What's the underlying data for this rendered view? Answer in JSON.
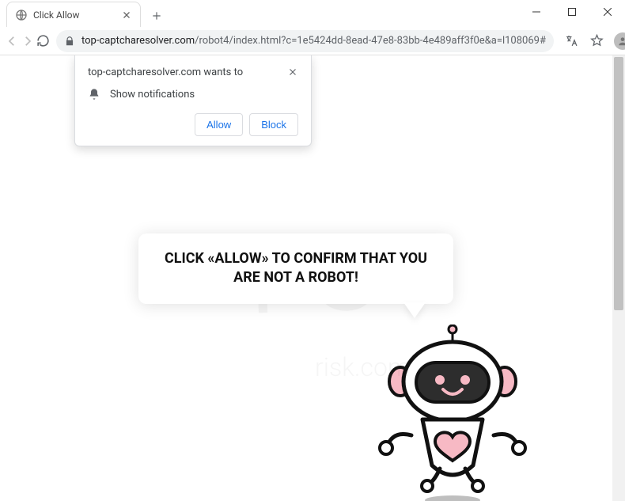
{
  "browser": {
    "tab_title": "Click Allow",
    "url_host": "top-captcharesolver.com",
    "url_path": "/robot4/index.html?c=1e5424dd-8ead-47e8-83bb-4e489aff3f0e&a=l108069#"
  },
  "notification_prompt": {
    "site_line": "top-captcharesolver.com wants to",
    "permission_label": "Show notifications",
    "allow_label": "Allow",
    "block_label": "Block"
  },
  "page": {
    "speech_text": "CLICK «ALLOW» TO CONFIRM THAT YOU ARE NOT A ROBOT!"
  },
  "watermark": {
    "main": "PC",
    "sub": "risk.com"
  }
}
